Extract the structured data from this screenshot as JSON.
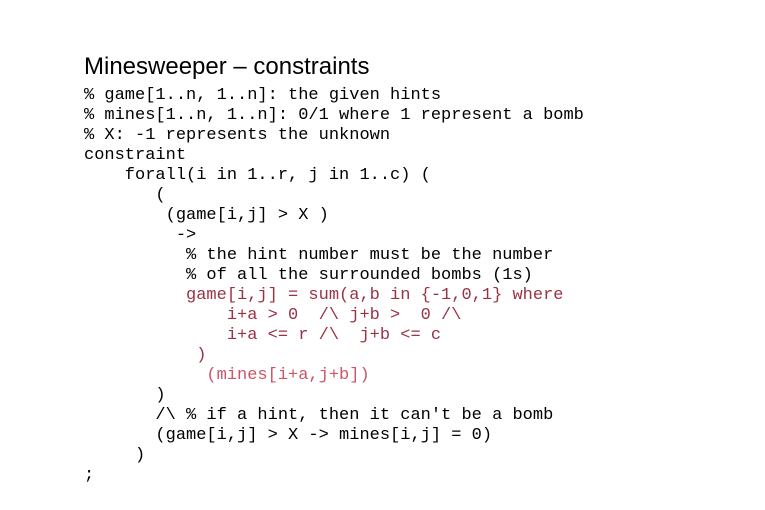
{
  "slide": {
    "title": "Minesweeper – constraints",
    "background_color": "#ffffff",
    "colors": {
      "text": "#000000",
      "dark_red": "#993344",
      "light_red": "#cc5566"
    }
  },
  "code": {
    "language": "MiniZinc",
    "lines": [
      {
        "text": "% game[1..n, 1..n]: the given hints",
        "color": "black"
      },
      {
        "text": "% mines[1..n, 1..n]: 0/1 where 1 represent a bomb",
        "color": "black"
      },
      {
        "text": "% X: -1 represents the unknown",
        "color": "black"
      },
      {
        "text": "constraint",
        "color": "black"
      },
      {
        "text": "    forall(i in 1..r, j in 1..c) (",
        "color": "black"
      },
      {
        "text": "       (",
        "color": "black"
      },
      {
        "text": "        (game[i,j] > X )",
        "color": "black"
      },
      {
        "text": "         ->",
        "color": "black"
      },
      {
        "text": "          % the hint number must be the number",
        "color": "black"
      },
      {
        "text": "          % of all the surrounded bombs (1s)",
        "color": "black"
      },
      {
        "text": "          game[i,j] = sum(a,b in {-1,0,1} where",
        "color": "dark_red"
      },
      {
        "text": "              i+a > 0  /\\ j+b >  0 /\\",
        "color": "dark_red"
      },
      {
        "text": "              i+a <= r /\\  j+b <= c",
        "color": "dark_red"
      },
      {
        "text": "           )",
        "color": "dark_red"
      },
      {
        "text": "            (mines[i+a,j+b])",
        "color": "light_red"
      },
      {
        "text": "       )",
        "color": "black"
      },
      {
        "text": "       /\\ % if a hint, then it can't be a bomb",
        "color": "black"
      },
      {
        "text": "       (game[i,j] > X -> mines[i,j] = 0)",
        "color": "black"
      },
      {
        "text": "     )",
        "color": "black"
      },
      {
        "text": ";",
        "color": "black"
      }
    ]
  }
}
